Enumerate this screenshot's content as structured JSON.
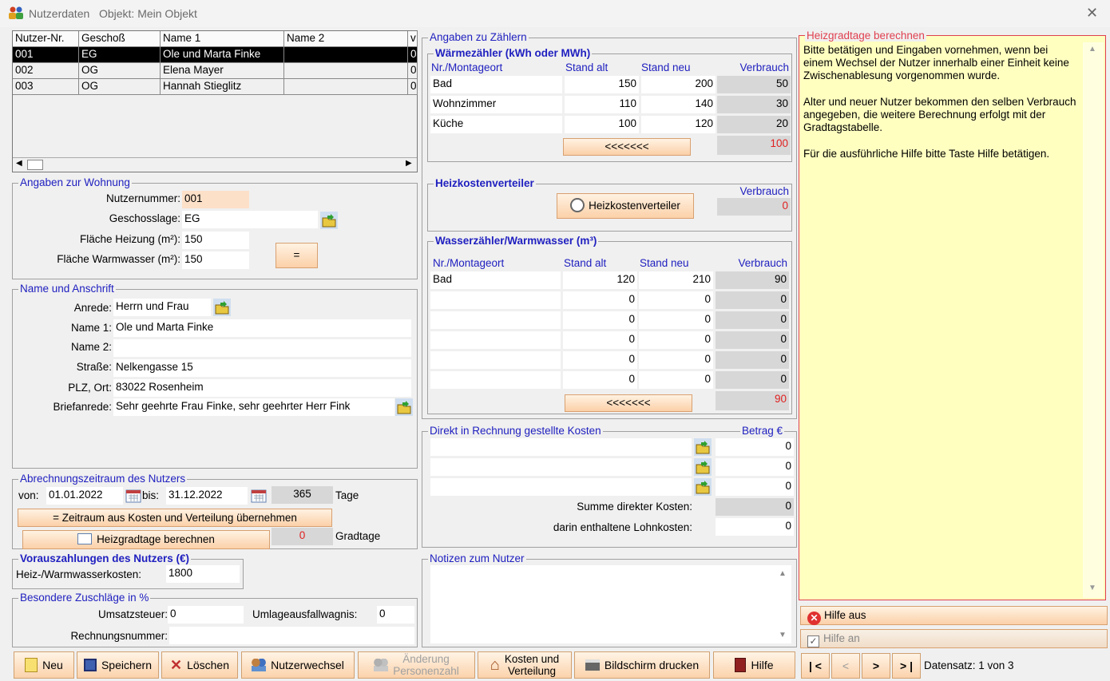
{
  "window": {
    "title": "Nutzerdaten",
    "subtitle": "Objekt: Mein Objekt"
  },
  "users_table": {
    "headers": [
      "Nutzer-Nr.",
      "Geschoß",
      "Name 1",
      "Name 2",
      "V"
    ],
    "rows": [
      {
        "nr": "001",
        "geschoss": "EG",
        "name1": "Ole und Marta Finke",
        "name2": "",
        "v": "0",
        "selected": true
      },
      {
        "nr": "002",
        "geschoss": "OG",
        "name1": "Elena Mayer",
        "name2": "",
        "v": "0",
        "selected": false
      },
      {
        "nr": "003",
        "geschoss": "OG",
        "name1": "Hannah Stieglitz",
        "name2": "",
        "v": "0",
        "selected": false
      }
    ]
  },
  "wohnung": {
    "legend": "Angaben zur Wohnung",
    "nutzernummer_label": "Nutzernummer:",
    "nutzernummer": "001",
    "geschosslage_label": "Geschosslage:",
    "geschosslage": "EG",
    "flaeche_heizung_label": "Fläche Heizung (m²):",
    "flaeche_heizung": "150",
    "flaeche_ww_label": "Fläche Warmwasser (m²):",
    "flaeche_ww": "150",
    "equal_btn": "="
  },
  "anschrift": {
    "legend": "Name und Anschrift",
    "anrede_label": "Anrede:",
    "anrede": "Herrn und Frau",
    "name1_label": "Name 1:",
    "name1": "Ole und Marta Finke",
    "name2_label": "Name 2:",
    "name2": "",
    "strasse_label": "Straße:",
    "strasse": "Nelkengasse 15",
    "plz_label": "PLZ, Ort:",
    "plz": "83022 Rosenheim",
    "brief_label": "Briefanrede:",
    "brief": "Sehr geehrte Frau Finke, sehr geehrter Herr Fink"
  },
  "zeitraum": {
    "legend": "Abrechnungszeitraum des Nutzers",
    "von_label": "von:",
    "von": "01.01.2022",
    "bis_label": "bis:",
    "bis": "31.12.2022",
    "tage": "365",
    "tage_label": "Tage",
    "uebernehmen_btn": "= Zeitraum aus Kosten und Verteilung übernehmen",
    "heizgrad_btn": "Heizgradtage berechnen",
    "gradtage": "0",
    "gradtage_label": "Gradtage"
  },
  "voraus": {
    "legend": "Vorauszahlungen des Nutzers (€)",
    "label": "Heiz-/Warmwasserkosten:",
    "value": "1800"
  },
  "zuschlaege": {
    "legend": "Besondere Zuschläge in %",
    "ust_label": "Umsatzsteuer:",
    "ust": "0",
    "umlage_label": "Umlageausfallwagnis:",
    "umlage": "0",
    "rechnung_label": "Rechnungsnummer:",
    "rechnung": ""
  },
  "zaehler": {
    "legend": "Angaben zu Zählern",
    "waerme_legend": "Wärmezähler (kWh oder MWh)",
    "col_ort": "Nr./Montageort",
    "col_alt": "Stand alt",
    "col_neu": "Stand neu",
    "col_verbrauch": "Verbrauch",
    "waerme_rows": [
      {
        "ort": "Bad",
        "alt": "150",
        "neu": "200",
        "verbrauch": "50"
      },
      {
        "ort": "Wohnzimmer",
        "alt": "110",
        "neu": "140",
        "verbrauch": "30"
      },
      {
        "ort": "Küche",
        "alt": "100",
        "neu": "120",
        "verbrauch": "20"
      }
    ],
    "waerme_back_btn": "<<<<<<<",
    "waerme_total": "100",
    "hkv_legend": "Heizkostenverteiler",
    "hkv_verbrauch_label": "Verbrauch",
    "hkv_btn": "Heizkostenverteiler",
    "hkv_total": "0",
    "wasser_legend": "Wasserzähler/Warmwasser (m³)",
    "wasser_rows": [
      {
        "ort": "Bad",
        "alt": "120",
        "neu": "210",
        "verbrauch": "90"
      },
      {
        "ort": "",
        "alt": "0",
        "neu": "0",
        "verbrauch": "0"
      },
      {
        "ort": "",
        "alt": "0",
        "neu": "0",
        "verbrauch": "0"
      },
      {
        "ort": "",
        "alt": "0",
        "neu": "0",
        "verbrauch": "0"
      },
      {
        "ort": "",
        "alt": "0",
        "neu": "0",
        "verbrauch": "0"
      },
      {
        "ort": "",
        "alt": "0",
        "neu": "0",
        "verbrauch": "0"
      }
    ],
    "wasser_back_btn": "<<<<<<<",
    "wasser_total": "90"
  },
  "direkt": {
    "legend": "Direkt in Rechnung gestellte Kosten",
    "betrag_label": "Betrag €",
    "rows": [
      {
        "text": "",
        "betrag": "0"
      },
      {
        "text": "",
        "betrag": "0"
      },
      {
        "text": "",
        "betrag": "0"
      }
    ],
    "summe_label": "Summe direkter Kosten:",
    "summe": "0",
    "lohn_label": "darin enthaltene Lohnkosten:",
    "lohn": "0"
  },
  "notizen": {
    "legend": "Notizen zum Nutzer",
    "text": ""
  },
  "help": {
    "legend": "Heizgradtage berechnen",
    "text": "Bitte betätigen und Eingaben vornehmen, wenn bei einem Wechsel der Nutzer innerhalb einer Einheit keine Zwischenablesung vorgenommen wurde.\n\nAlter und neuer Nutzer bekommen den selben Verbrauch angegeben, die weitere Berechnung erfolgt mit der Gradtagstabelle.\n\nFür die ausführliche Hilfe bitte Taste Hilfe betätigen.",
    "hilfe_aus": "Hilfe aus",
    "hilfe_an": "Hilfe an"
  },
  "toolbar": {
    "neu": "Neu",
    "speichern": "Speichern",
    "loeschen": "Löschen",
    "nutzerwechsel": "Nutzerwechsel",
    "aenderung_1": "Änderung",
    "aenderung_2": "Personenzahl",
    "kosten_1": "Kosten und",
    "kosten_2": "Verteilung",
    "drucken": "Bildschirm drucken",
    "hilfe": "Hilfe"
  },
  "nav": {
    "first": "| <",
    "prev": "<",
    "next": ">",
    "last": "> |",
    "datensatz": "Datensatz: 1 von 3"
  },
  "colors": {
    "legend_blue": "#2020c0",
    "peach_input": "#fde0c8",
    "help_bg": "#ffffc0",
    "help_border": "#e04050",
    "red_value": "#e02020"
  }
}
